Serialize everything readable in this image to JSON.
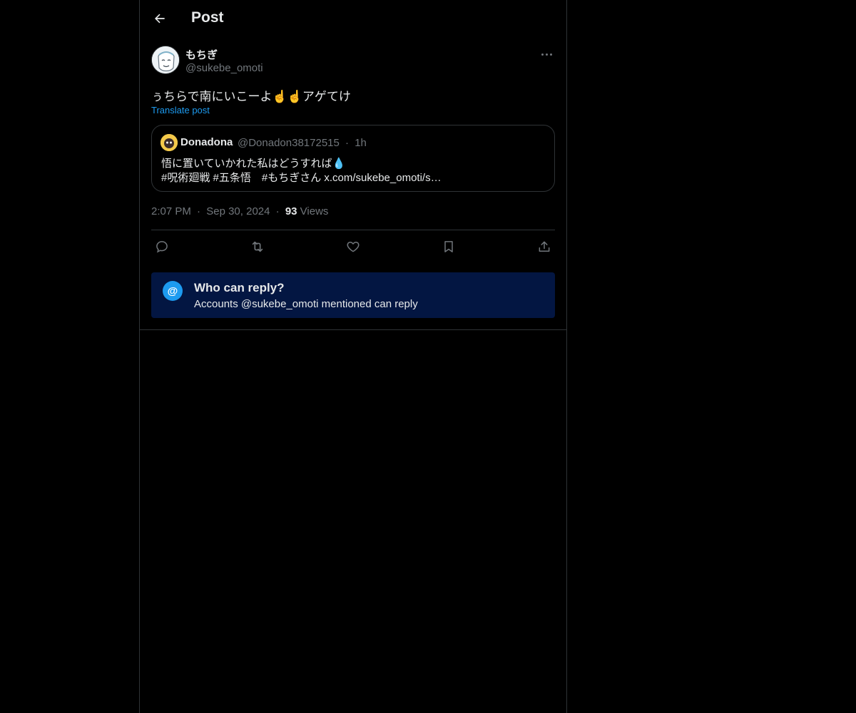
{
  "header": {
    "title": "Post",
    "back_icon": "arrow-left-icon"
  },
  "post": {
    "author_name": "もちぎ",
    "author_handle": "@sukebe_omoti",
    "text": "ぅちらで南にいこーよ☝️☝️アゲてけ",
    "translate_label": "Translate post",
    "quote": {
      "author_name": "Donadona",
      "author_handle": "@Donadon38172515",
      "separator": "·",
      "time": "1h",
      "line1": "悟に置いていかれた私はどうすれば💧",
      "line2": "#呪術廻戦 #五条悟　#もちぎさん x.com/sukebe_omoti/s…"
    },
    "time": "2:07 PM",
    "dot": "·",
    "date": "Sep 30, 2024",
    "views_count": "93",
    "views_label": "Views"
  },
  "actions": [
    "reply-icon",
    "repost-icon",
    "like-icon",
    "bookmark-icon",
    "share-icon"
  ],
  "reply_restriction": {
    "icon": "@",
    "title": "Who can reply?",
    "subtitle": "Accounts @sukebe_omoti mentioned can reply"
  },
  "colors": {
    "background": "#000000",
    "text": "#e7e9ea",
    "secondary": "#71767b",
    "accent": "#1d9bf0",
    "reply_box": "#031642",
    "border": "#2f3336"
  }
}
